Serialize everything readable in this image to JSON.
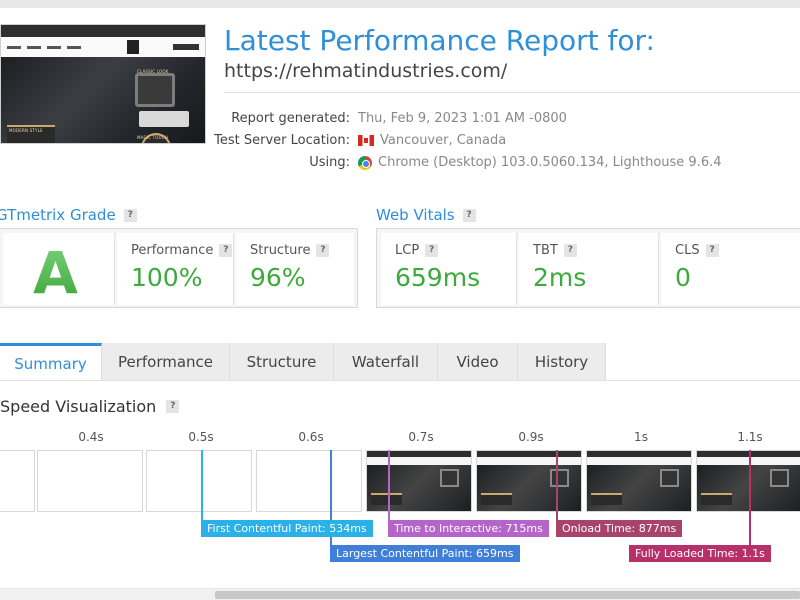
{
  "report": {
    "title": "Latest Performance Report for:",
    "url": "https://rehmatindustries.com/"
  },
  "meta": [
    {
      "label": "Report generated:",
      "value": "Thu, Feb 9, 2023 1:01 AM -0800",
      "icon": ""
    },
    {
      "label": "Test Server Location:",
      "value": "Vancouver, Canada",
      "icon": "canada-flag-icon"
    },
    {
      "label": "Using:",
      "value": "Chrome (Desktop) 103.0.5060.134, Lighthouse 9.6.4",
      "icon": "chrome-icon"
    }
  ],
  "thumbnail": {
    "banner_left": "MODERN STYLE",
    "banner_right": "CLASSIC LOOK",
    "banner_bottom": "MAGIC TOUCH"
  },
  "gtmetrix": {
    "title": "GTmetrix Grade",
    "help": "?",
    "grade": "A",
    "performance_label": "Performance",
    "performance_value": "100%",
    "structure_label": "Structure",
    "structure_value": "96%"
  },
  "web_vitals": {
    "title": "Web Vitals",
    "help": "?",
    "items": [
      {
        "label": "LCP",
        "value": "659ms"
      },
      {
        "label": "TBT",
        "value": "2ms"
      },
      {
        "label": "CLS",
        "value": "0"
      }
    ]
  },
  "tabs": [
    {
      "label": "Summary",
      "active": true
    },
    {
      "label": "Performance",
      "active": false
    },
    {
      "label": "Structure",
      "active": false
    },
    {
      "label": "Waterfall",
      "active": false
    },
    {
      "label": "Video",
      "active": false
    },
    {
      "label": "History",
      "active": false
    }
  ],
  "speed": {
    "title": "Speed Visualization",
    "help": "?",
    "ticks": [
      "0.4s",
      "0.5s",
      "0.6s",
      "0.7s",
      "0.9s",
      "1s",
      "1.1s"
    ],
    "markers": [
      {
        "label": "First Contentful Paint: 534ms",
        "color": "#29b1e8"
      },
      {
        "label": "Largest Contentful Paint: 659ms",
        "color": "#3f7fd8"
      },
      {
        "label": "Time to Interactive: 715ms",
        "color": "#b565c9"
      },
      {
        "label": "Onload Time: 877ms",
        "color": "#a8446a"
      },
      {
        "label": "Fully Loaded Time: 1.1s",
        "color": "#b8306a"
      }
    ]
  },
  "colors": {
    "accent": "#2f8fd8",
    "good": "#3daa3d"
  }
}
